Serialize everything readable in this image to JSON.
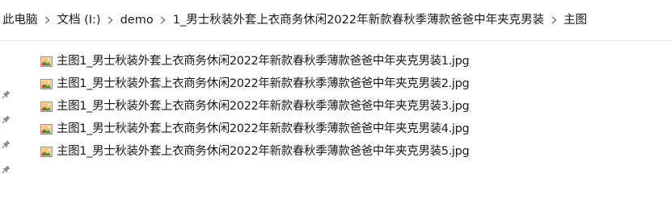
{
  "breadcrumb": {
    "segments": [
      "此电脑",
      "文档 (I:)",
      "demo",
      "1_男士秋装外套上衣商务休闲2022年新款春秋季薄款爸爸中年夹克男装",
      "主图"
    ],
    "separator_icon": "chevron-right-icon"
  },
  "quick_access": {
    "pin_icon": "pin-icon",
    "pin_count": 4
  },
  "files": [
    {
      "name": "主图1_男士秋装外套上衣商务休闲2022年新款春秋季薄款爸爸中年夹克男装1.jpg",
      "icon": "jpg-image-file-icon"
    },
    {
      "name": "主图1_男士秋装外套上衣商务休闲2022年新款春秋季薄款爸爸中年夹克男装2.jpg",
      "icon": "jpg-image-file-icon"
    },
    {
      "name": "主图1_男士秋装外套上衣商务休闲2022年新款春秋季薄款爸爸中年夹克男装3.jpg",
      "icon": "jpg-image-file-icon"
    },
    {
      "name": "主图1_男士秋装外套上衣商务休闲2022年新款春秋季薄款爸爸中年夹克男装4.jpg",
      "icon": "jpg-image-file-icon"
    },
    {
      "name": "主图1_男士秋装外套上衣商务休闲2022年新款春秋季薄款爸爸中年夹克男装5.jpg",
      "icon": "jpg-image-file-icon"
    }
  ],
  "colors": {
    "text": "#1a1a1a",
    "separator": "#6e6e6e",
    "pin": "#8a8a8a",
    "background": "#ffffff"
  }
}
